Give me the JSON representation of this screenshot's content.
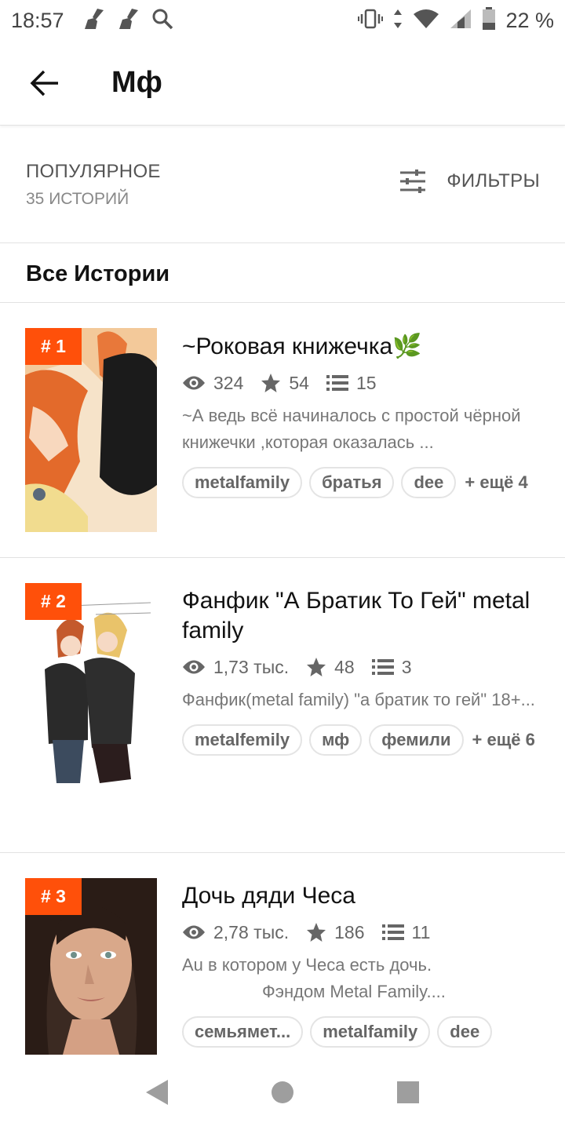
{
  "status_bar": {
    "time": "18:57",
    "battery": "22 %",
    "icons_left": [
      "broom-icon",
      "broom-icon",
      "search-icon"
    ],
    "icons_right": [
      "vibrate-icon",
      "data-arrows-icon",
      "wifi-icon",
      "signal-icon",
      "battery-icon"
    ]
  },
  "app_bar": {
    "title": "Мф",
    "back_icon": "arrow-left-icon"
  },
  "sort": {
    "label": "ПОПУЛЯРНОЕ",
    "count": "35 ИСТОРИЙ",
    "filters_label": "ФИЛЬТРЫ",
    "filters_icon": "sliders-icon"
  },
  "section": {
    "title": "Все Истории"
  },
  "stories": [
    {
      "rank": "# 1",
      "title": "~Роковая книжечка🌿",
      "views": "324",
      "votes": "54",
      "parts": "15",
      "description": "~А ведь всё начиналось с простой чёрной книжечки ,которая оказалась ...",
      "tags": [
        "metalfamily",
        "братья",
        "dee"
      ],
      "more": "+ ещё 4"
    },
    {
      "rank": "# 2",
      "title": "Фанфик \"А Братик То Гей\" metal family",
      "views": "1,73 тыс.",
      "votes": "48",
      "parts": "3",
      "description": "Фанфик(metal family) \"а братик то гей\" 18+...",
      "tags": [
        "metalfemily",
        "мф",
        "фемили"
      ],
      "more": "+ ещё 6"
    },
    {
      "rank": "# 3",
      "title": "Дочь дяди Чеса",
      "views": "2,78 тыс.",
      "votes": "186",
      "parts": "11",
      "description_line1": "Au в котором у Чеса есть дочь.",
      "description_line2": "Фэндом Metal Family....",
      "tags": [
        "семьямет...",
        "metalfamily",
        "dee"
      ]
    }
  ],
  "colors": {
    "rank_badge": "#ff500a",
    "text_primary": "#121212",
    "text_secondary": "#777777",
    "divider": "#e2e2e2"
  },
  "nav": {
    "back": "triangle-back-icon",
    "home": "circle-home-icon",
    "recents": "square-recents-icon"
  }
}
